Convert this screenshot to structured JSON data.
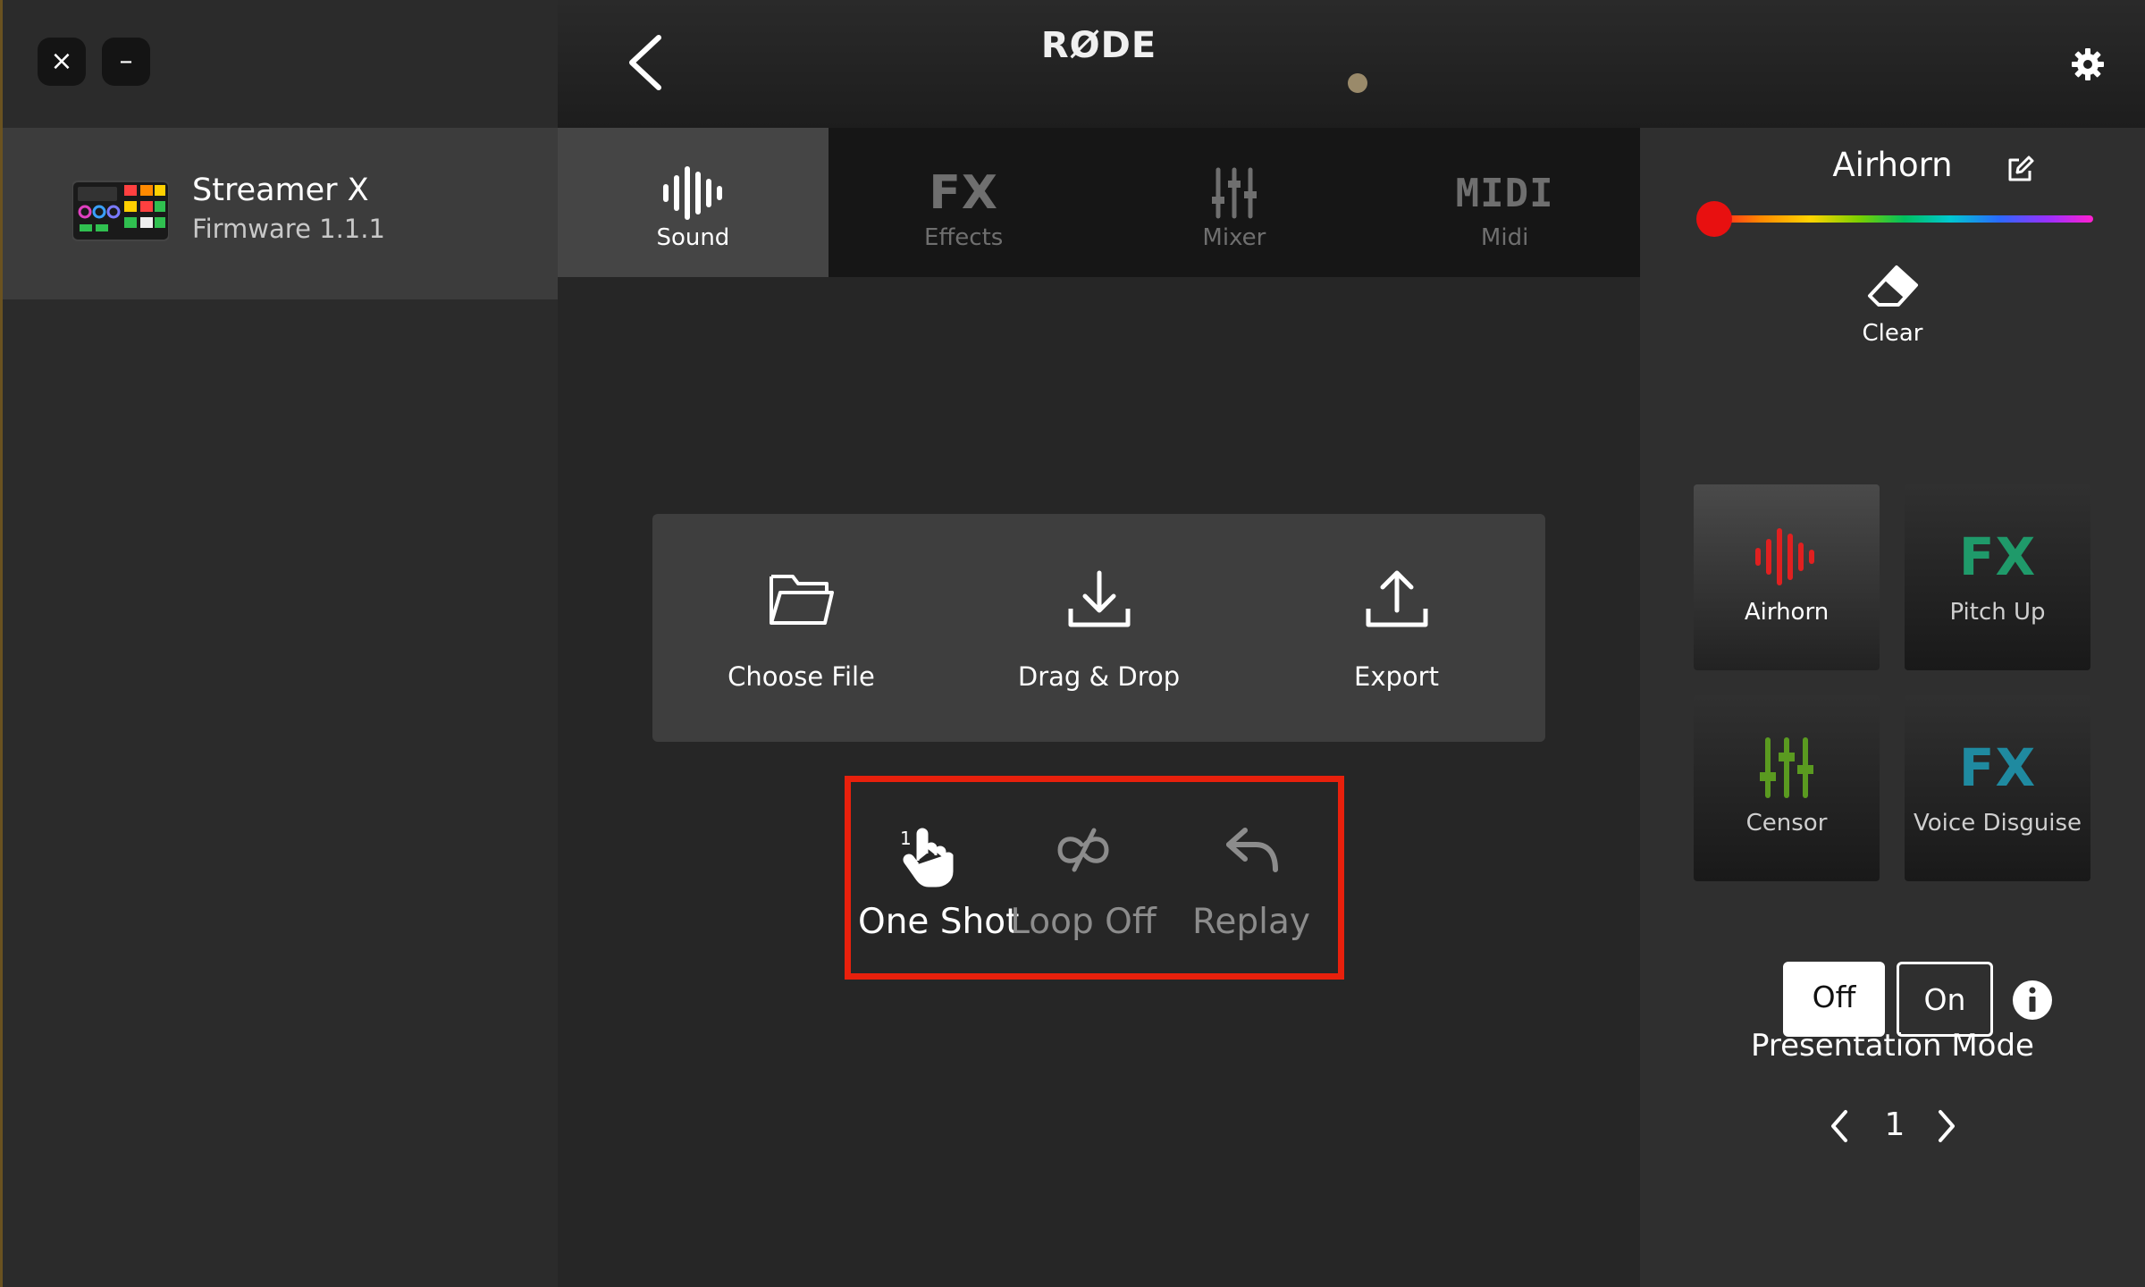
{
  "window": {
    "close_glyph": "×",
    "minimize_glyph": "–"
  },
  "device": {
    "name": "Streamer X",
    "firmware": "Firmware 1.1.1"
  },
  "header": {
    "brand": "RØDE"
  },
  "tabs": [
    {
      "label": "Sound",
      "icon": "waveform-icon",
      "active": true
    },
    {
      "label": "Effects",
      "icon": "fx-icon",
      "glyph": "FX",
      "active": false
    },
    {
      "label": "Mixer",
      "icon": "mixer-sliders-icon",
      "active": false
    },
    {
      "label": "Midi",
      "icon": "midi-icon",
      "glyph": "MIDI",
      "active": false
    }
  ],
  "file_actions": [
    {
      "label": "Choose File",
      "icon": "folder-icon"
    },
    {
      "label": "Drag & Drop",
      "icon": "download-icon"
    },
    {
      "label": "Export",
      "icon": "upload-icon"
    }
  ],
  "play_modes": [
    {
      "label": "One Shot",
      "icon": "tap-hand-icon",
      "badge": "1",
      "active": true
    },
    {
      "label": "Loop Off",
      "icon": "loop-off-icon",
      "active": false
    },
    {
      "label": "Replay",
      "icon": "replay-icon",
      "active": false
    }
  ],
  "pad_editor": {
    "pad_name": "Airhorn",
    "clear_label": "Clear",
    "selected_color": "#e81010"
  },
  "pads": [
    {
      "label": "Airhorn",
      "icon": "waveform-icon",
      "color": "#e02020",
      "selected": true
    },
    {
      "label": "Pitch Up",
      "icon": "fx-icon",
      "glyph": "FX",
      "color": "#1f9a6a",
      "selected": false
    },
    {
      "label": "Censor",
      "icon": "mixer-sliders-icon",
      "color": "#5a9a20",
      "selected": false
    },
    {
      "label": "Voice Disguise",
      "icon": "fx-icon",
      "glyph": "FX",
      "color": "#1f8aa0",
      "selected": false
    }
  ],
  "presentation_mode": {
    "title": "Presentation Mode",
    "off_label": "Off",
    "on_label": "On",
    "value": "Off"
  },
  "pager": {
    "page": "1"
  }
}
